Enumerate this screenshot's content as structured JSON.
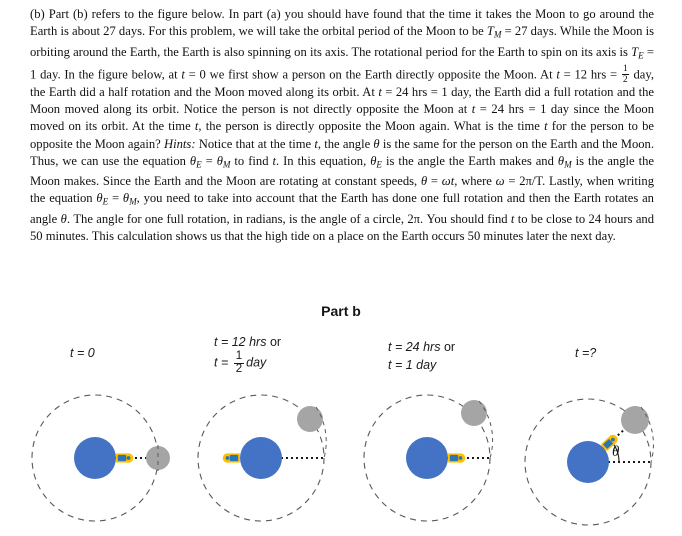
{
  "document": {
    "paragraph_part_label": "(b)",
    "body_text": "Part (b) refers to the figure below. In part (a) you should have found that the time it takes the Moon to go around the Earth is about 27 days. For this problem, we will take the orbital period of the Moon to be TM = 27 days. While the Moon is orbiting around the Earth, the Earth is also spinning on its axis. The rotational period for the Earth to spin on its axis is TE = 1 day. In the figure below, at t = 0 we first show a person on the Earth directly opposite the Moon. At t = 12 hrs = 1/2 day, the Earth did a half rotation and the Moon moved along its orbit. At t = 24 hrs = 1 day, the Earth did a full rotation and the Moon moved along its orbit. Notice the person is not directly opposite the Moon at t = 24 hrs = 1 day since the Moon moved on its orbit. At the time t, the person is directly opposite the Moon again. What is the time t for the person to be opposite the Moon again? Hints: Notice that at the time t, the angle θ is the same for the person on the Earth and the Moon. Thus, we can use the equation θE = θM to find t. In this equation, θE is the angle the Earth makes and θM is the angle the Moon makes. Since the Earth and the Moon are rotating at constant speeds, θ = ωt, where ω = 2π/T. Lastly, when writing the equation θE = θM, you need to take into account that the Earth has done one full rotation and then the Earth rotates an angle θ. The angle for one full rotation, in radians, is the angle of a circle, 2π. You should find t to be close to 24 hours and 50 minutes. This calculation shows us that the high tide on a place on the Earth occurs 50 minutes later the next day.",
    "segments": {
      "s1": "Part (b) refers to the figure below. In part (a) you should have found that the time it takes the Moon to go around the Earth is about 27 days. For this problem, we will take the orbital period of the Moon to be ",
      "sym_TM": "T",
      "sub_M": "M",
      "s2": " = 27 days. While the Moon is orbiting around the Earth, the Earth is also spinning on its axis. The rotational period for the Earth to spin on its axis is ",
      "sym_TE": "T",
      "sub_E": "E",
      "s3": " = 1 day. In the figure below, at ",
      "sym_t1": "t",
      "s4": " = 0 we first show a person on the Earth directly opposite the Moon. At ",
      "sym_t2": "t",
      "s5": " = 12 hrs = ",
      "frac_num": "1",
      "frac_den": "2",
      "s6": " day, the Earth did a half rotation and the Moon moved along its orbit. At ",
      "sym_t3": "t",
      "s7": " = 24 hrs = 1 day, the Earth did a full rotation and the Moon moved along its orbit. Notice the person is not directly opposite the Moon at ",
      "sym_t4": "t",
      "s8": " = 24 hrs = 1 day since the Moon moved on its orbit. At the time ",
      "sym_t5": "t",
      "s9": ", the person is directly opposite the Moon again. What is the time ",
      "sym_t6": "t",
      "s10": " for the person to be opposite the Moon again? ",
      "hints_label": "Hints:",
      "s11": " Notice that at the time ",
      "sym_t7": "t",
      "s12": ", the angle ",
      "sym_theta1": "θ",
      "s13": " is the same for the person on the Earth and the Moon. Thus, we can use the equation ",
      "sym_thetaE": "θ",
      "sub_E2": "E",
      "eq1": " = ",
      "sym_thetaM": "θ",
      "sub_M2": "M",
      "s14": " to find ",
      "sym_t8": "t",
      "s15": ". In this equation, ",
      "sym_thetaE2": "θ",
      "sub_E3": "E",
      "s16": " is the angle the Earth makes and ",
      "sym_thetaM2": "θ",
      "sub_M3": "M",
      "s17": " is the angle the Moon makes. Since the Earth and the Moon are rotating at constant speeds, ",
      "sym_theta2": "θ",
      "s18": " = ",
      "sym_omega_t": "ωt",
      "s19": ", where ",
      "sym_omega": "ω",
      "s20": " = 2π/T",
      "s21": ". Lastly, when writing the equation ",
      "sym_thetaE3": "θ",
      "sub_E4": "E",
      "s22": " = ",
      "sym_thetaM3": "θ",
      "sub_M4": "M",
      "s23": ", you need to take into account that the Earth has done one full rotation and then the Earth rotates an angle ",
      "sym_theta3": "θ",
      "s24": ". The angle for one full rotation, in radians, is the angle of a circle, 2π. You should find ",
      "sym_t9": "t",
      "s25": " to be close to 24 hours and 50 minutes. This calculation shows us that the high tide on a place on the Earth occurs 50 minutes later the next day."
    }
  },
  "figure": {
    "heading": "Part b",
    "panels": [
      {
        "id": "panel-1",
        "label_lines": [
          "t = 0"
        ],
        "label_kind": "simple",
        "time_value": "0",
        "earth_rotation_description": "person on right side of Earth, directly opposite the Moon",
        "person_angle_deg": 0,
        "moon_angle_deg": 0
      },
      {
        "id": "panel-2",
        "label_kind": "fraction",
        "label_line_1_pre": "t = 12 ",
        "label_line_1_it": "hrs",
        "label_line_1_post": " or",
        "label_line_2_pre": "t = ",
        "frac_num": "1",
        "frac_den": "2",
        "label_line_2_post": "day",
        "time_value": "12 hrs",
        "earth_rotation_description": "person on left side of Earth after half rotation; Moon advanced along orbit",
        "person_angle_deg": 180,
        "moon_angle_deg": 40
      },
      {
        "id": "panel-3",
        "label_kind": "two-line",
        "label_line_1_pre": "t = 24 ",
        "label_line_1_it": "hrs",
        "label_line_1_post": " or",
        "label_line_2_pre": "t = 1 ",
        "label_line_2_it": "day",
        "time_value": "24 hrs",
        "earth_rotation_description": "person back on right side of Earth after full rotation; Moon further along orbit so person is not opposite Moon",
        "person_angle_deg": 0,
        "moon_angle_deg": 48
      },
      {
        "id": "panel-4",
        "label_kind": "simple",
        "label_lines": [
          "t =?"
        ],
        "time_value": "?",
        "earth_rotation_description": "person aligned with Moon again at angle theta above horizontal",
        "angle_label": "θ",
        "person_angle_deg": 42,
        "moon_angle_deg": 42
      }
    ],
    "colors": {
      "earth": "#4472C4",
      "moon": "#A5A5A5",
      "orbit_dash": "#595959",
      "person_body": "#2E75B6",
      "person_outline": "#FFC000",
      "dotted_line": "#1a1a1a",
      "angle_label": "#1a1a1a"
    },
    "geometry": {
      "orbit_radius_px": 63,
      "earth_radius_px": 21,
      "moon_radius_px": 12
    }
  }
}
